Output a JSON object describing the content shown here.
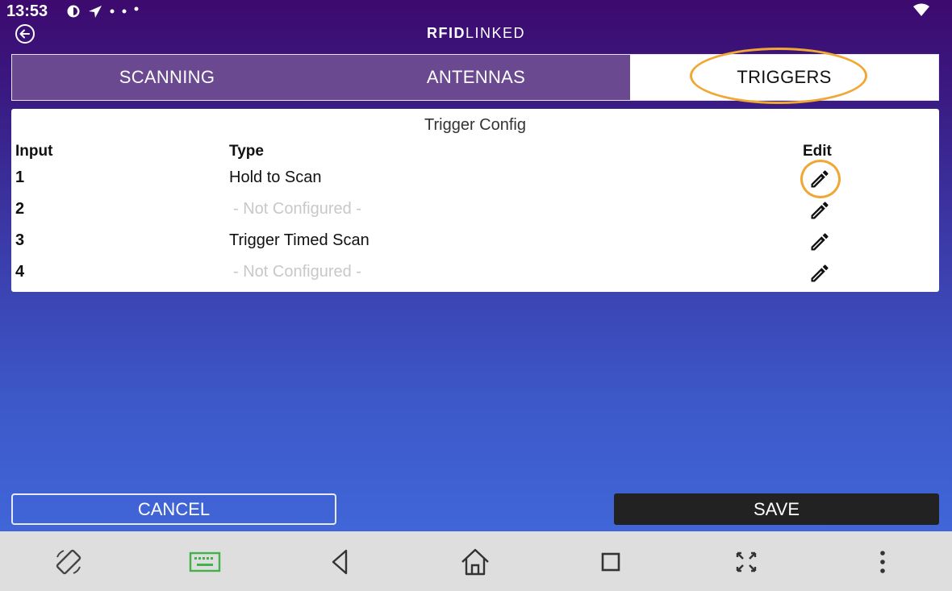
{
  "status_bar": {
    "time": "13:53",
    "icons": [
      "data-saver-icon",
      "location-arrow-icon",
      "dot-icon",
      "dot-icon",
      "dot-icon",
      "wifi-icon"
    ]
  },
  "app_bar": {
    "title_bold": "RFID",
    "title_light": "LINKED",
    "back_icon": "back-arrow-icon"
  },
  "tabs": [
    {
      "label": "SCANNING",
      "selected": false
    },
    {
      "label": "ANTENNAS",
      "selected": false
    },
    {
      "label": "TRIGGERS",
      "selected": true
    }
  ],
  "trigger_config": {
    "title": "Trigger Config",
    "headers": {
      "input": "Input",
      "type": "Type",
      "edit": "Edit"
    },
    "rows": [
      {
        "input": "1",
        "type": "Hold to Scan",
        "configured": true
      },
      {
        "input": "2",
        "type": "- Not Configured -",
        "configured": false
      },
      {
        "input": "3",
        "type": "Trigger Timed Scan",
        "configured": true
      },
      {
        "input": "4",
        "type": "- Not Configured -",
        "configured": false
      }
    ],
    "edit_icon": "pencil-icon"
  },
  "actions": {
    "cancel_label": "CANCEL",
    "save_label": "SAVE"
  },
  "nav_bar": {
    "icons": [
      "rotate-icon",
      "keyboard-icon",
      "back-triangle-icon",
      "home-icon",
      "recents-icon",
      "fullscreen-icon",
      "more-vert-icon"
    ]
  },
  "colors": {
    "highlight": "#f0a733",
    "tab_inactive": "#6a4991",
    "save_button": "#222222",
    "keyboard_icon": "#3fb24a"
  }
}
